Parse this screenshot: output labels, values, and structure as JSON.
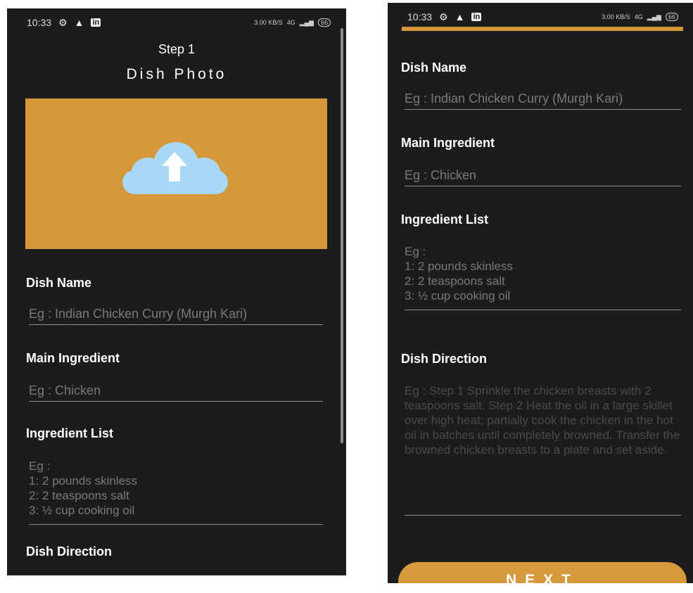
{
  "left": {
    "status_time": "10:33",
    "status_speed": "3.00 KB/S",
    "status_network": "4G",
    "battery": "66",
    "step": "Step 1",
    "photo_title": "Dish Photo",
    "dish_name_label": "Dish Name",
    "dish_name_placeholder": "Eg : Indian Chicken Curry (Murgh Kari)",
    "main_ingredient_label": "Main Ingredient",
    "main_ingredient_placeholder": "Eg : Chicken",
    "ingredient_list_label": "Ingredient List",
    "ingredient_list_placeholder": "Eg :\n1: 2 pounds skinless\n2: 2 teaspoons salt\n3: ½ cup cooking oil",
    "dish_direction_label": "Dish Direction"
  },
  "right": {
    "status_time": "10:33",
    "status_speed": "3.00 KB/S",
    "status_network": "4G",
    "battery": "66",
    "dish_name_label": "Dish Name",
    "dish_name_placeholder": "Eg : Indian Chicken Curry (Murgh Kari)",
    "main_ingredient_label": "Main Ingredient",
    "main_ingredient_placeholder": "Eg : Chicken",
    "ingredient_list_label": "Ingredient List",
    "ingredient_list_placeholder": "Eg :\n1: 2 pounds skinless\n2: 2 teaspoons salt\n3: ½ cup cooking oil",
    "dish_direction_label": "Dish Direction",
    "dish_direction_placeholder": "Eg : Step 1 Sprinkle the chicken breasts with 2 teaspoons salt. Step 2 Heat the oil in a large skillet over high heat; partially cook the chicken in the hot oil in batches until completely browned. Transfer the browned chicken breasts to a plate and set aside.",
    "next_label": "NEXT"
  },
  "colors": {
    "background": "#1c1b1d",
    "accent": "#d4983b",
    "cloud": "#a8d8f5"
  },
  "icons": {
    "settings": "gear-icon",
    "alert": "alert-icon",
    "linkedin": "linkedin-icon",
    "upload": "cloud-upload-icon"
  }
}
